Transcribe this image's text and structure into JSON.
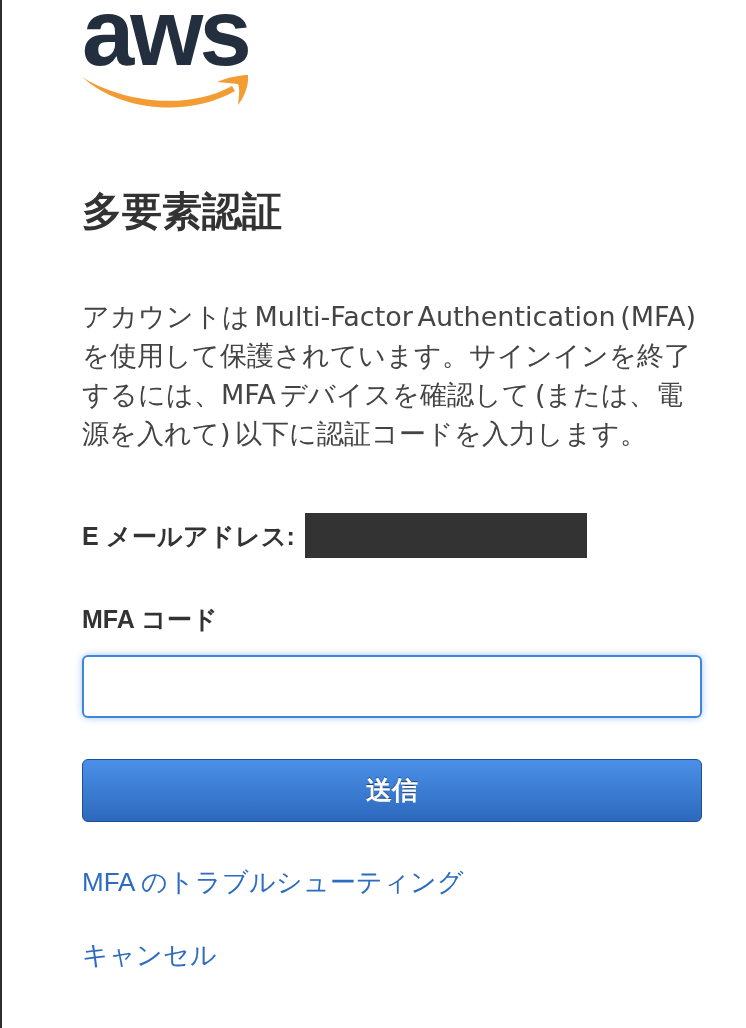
{
  "logo": {
    "text": "aws"
  },
  "heading": "多要素認証",
  "description": "アカウントは Multi-Factor Authentication (MFA) を使用して保護されています。サインインを終了するには、MFA デバイスを確認して (または、電源を入れて) 以下に認証コードを入力します。",
  "email": {
    "label": "E メールアドレス:",
    "redacted": true
  },
  "mfa_code": {
    "label": "MFA コード",
    "focused": true
  },
  "submit_button": {
    "label": "送信"
  },
  "links": {
    "troubleshooting": "MFA のトラブルシューティング",
    "cancel": "キャンセル"
  }
}
